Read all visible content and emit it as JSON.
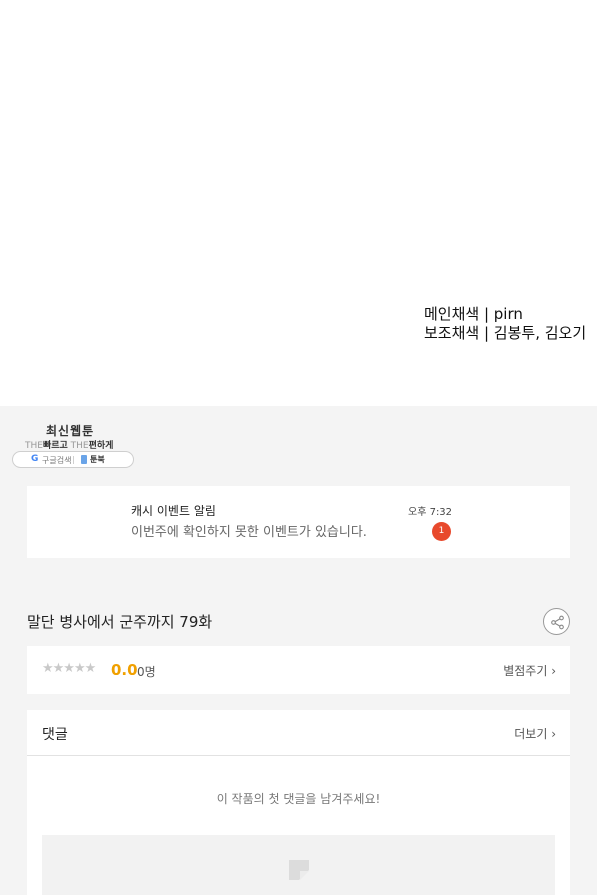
{
  "credits": {
    "main_color": "메인채색 | pirn",
    "sub_color": "보조채색 | 김봉투, 김오기"
  },
  "promo": {
    "title": "최신웹툰",
    "sub_the1": "THE",
    "sub_fast": "빠르고",
    "sub_the2": "THE",
    "sub_easy": "편하게",
    "google_glyph": "G",
    "google_search": "구글검색",
    "separator": "|",
    "toonbook": "툰북"
  },
  "notice": {
    "title": "캐시 이벤트 알림",
    "message": "이번주에 확인하지 못한 이벤트가 있습니다.",
    "time": "오후 7:32",
    "badge": "1"
  },
  "episode": {
    "title": "말단 병사에서 군주까지 79화"
  },
  "rating": {
    "stars": "★★★★★",
    "score": "0.0",
    "count": "0명",
    "rate_label": "별점주기 ›"
  },
  "comments": {
    "label": "댓글",
    "more_label": "더보기 ›",
    "empty_message": "이 작품의 첫 댓글을 남겨주세요!"
  },
  "icons": {
    "share": "share-icon",
    "pencil": "pencil-icon",
    "google": "google-icon",
    "book": "book-icon"
  },
  "colors": {
    "score": "#f0a000",
    "badge": "#e8492c",
    "background": "#f4f4f4"
  }
}
